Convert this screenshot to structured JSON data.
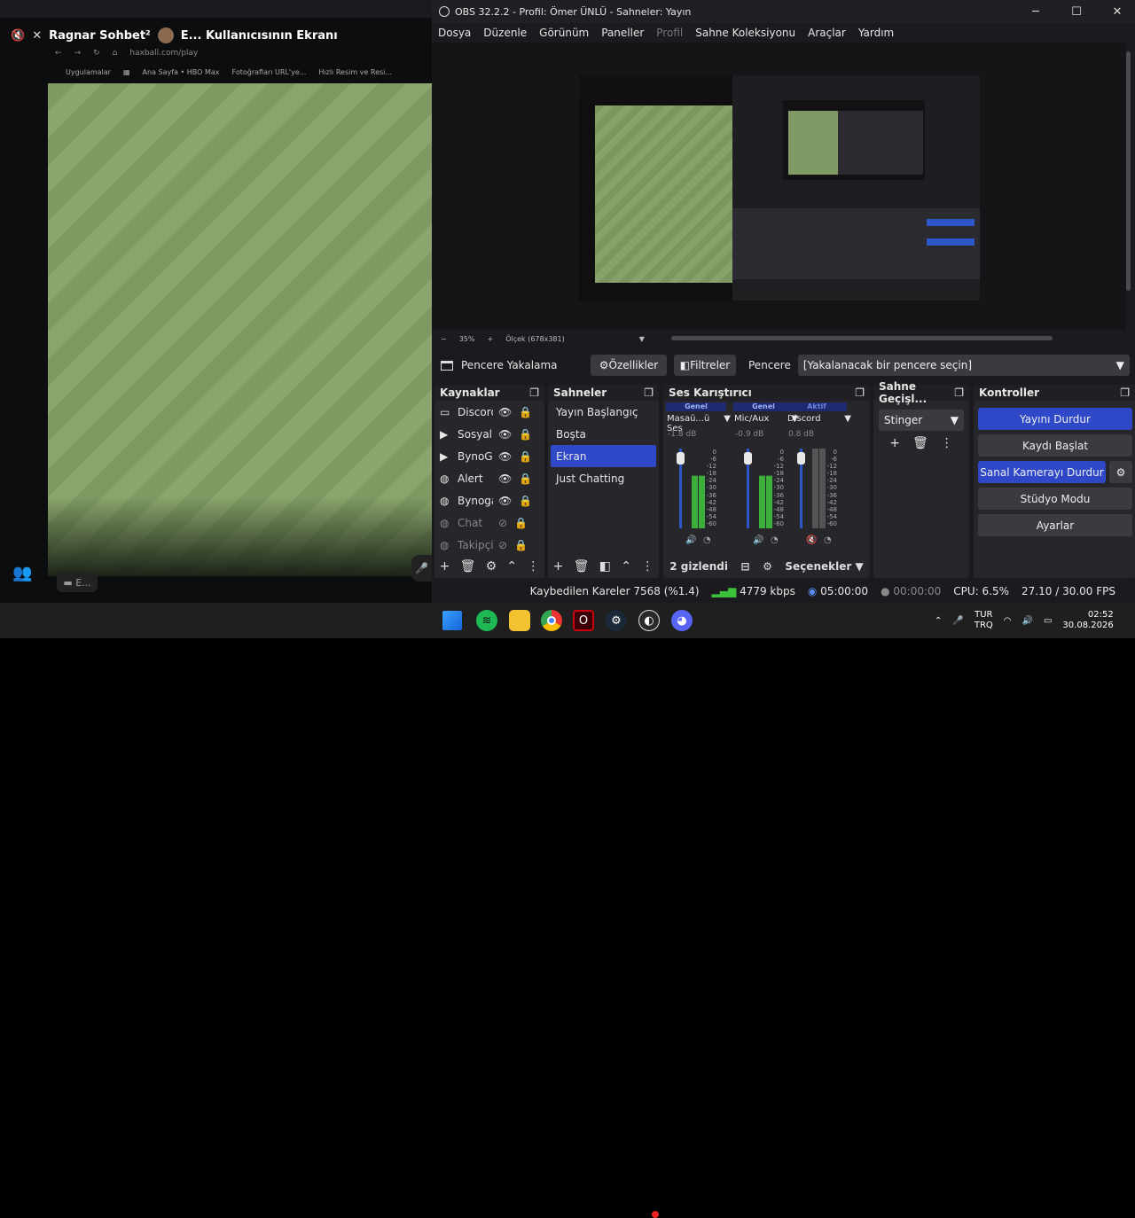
{
  "discord": {
    "title_user": "Ragnar Sohbet²",
    "title_screen": "E... Kullanıcısının Ekranı",
    "url": "haxball.com/play",
    "bookmarks": [
      "Uygulamalar",
      "Ana Sayfa • HBO Max",
      "Fotoğrafları URL'ye...",
      "Hızlı Resim ve Resi..."
    ],
    "chat_pill": "E..."
  },
  "obs": {
    "title": "OBS 32.2.2 - Profil: Ömer ÜNLÜ - Sahneler: Yayın",
    "menu": [
      "Dosya",
      "Düzenle",
      "Görünüm",
      "Paneller",
      "Profil",
      "Sahne Koleksiyonu",
      "Araçlar",
      "Yardım"
    ],
    "zoom": "35%",
    "scale": "Ölçek (678x381)",
    "source_bar": {
      "source_name": "Pencere Yakalama",
      "properties": "Özellikler",
      "filters": "Filtreler",
      "window_label": "Pencere",
      "window_value": "[Yakalanacak bir pencere seçin]"
    },
    "sources": {
      "title": "Kaynaklar",
      "items": [
        {
          "name": "Discord",
          "icon": "window-icon"
        },
        {
          "name": "Sosyal M",
          "icon": "play-icon"
        },
        {
          "name": "BynoGa",
          "icon": "play-icon"
        },
        {
          "name": "Alert",
          "icon": "globe-icon"
        },
        {
          "name": "Bynogar",
          "icon": "globe-icon"
        },
        {
          "name": "Chat",
          "icon": "globe-icon"
        },
        {
          "name": "Takipçi",
          "icon": "globe-icon"
        }
      ]
    },
    "scenes": {
      "title": "Sahneler",
      "items": [
        "Yayın Başlangıç",
        "Boşta",
        "Ekran",
        "Just Chatting"
      ],
      "selected": 2
    },
    "mixer": {
      "title": "Ses Karıştırıcı",
      "channels": [
        {
          "tag": "Genel",
          "name": "Masaü...ü Ses",
          "db": "-1.8 dB",
          "level": 0.66,
          "active": true
        },
        {
          "tag": "Genel",
          "name": "Mic/Aux",
          "db": "-0.9 dB",
          "level": 0.66,
          "active": true
        },
        {
          "tag": "Aktif",
          "name": "Discord",
          "db": "0.8 dB",
          "level": 0.0,
          "active": false
        }
      ],
      "scale": [
        "0",
        "-6",
        "-12",
        "-18",
        "-24",
        "-30",
        "-36",
        "-42",
        "-48",
        "-54",
        "-60"
      ],
      "hidden": "2 gizlendi",
      "options": "Seçenekler"
    },
    "transitions": {
      "title": "Sahne Geçişl...",
      "value": "Stinger"
    },
    "controls": {
      "title": "Kontroller",
      "stop_stream": "Yayını Durdur",
      "start_rec": "Kaydı Başlat",
      "stop_vcam": "Sanal Kamerayı Durdur",
      "studio": "Stüdyo Modu",
      "settings": "Ayarlar"
    },
    "status": {
      "dropped": "Kaybedilen Kareler 7568 (%1.4)",
      "bitrate": "4779 kbps",
      "stream_time": "05:00:00",
      "rec_time": "00:00:00",
      "cpu": "CPU: 6.5%",
      "fps": "27.10 / 30.00 FPS"
    }
  },
  "taskbar": {
    "lang1": "TUR",
    "lang2": "TRQ",
    "time": "02:52",
    "date": "30.08.2026"
  }
}
